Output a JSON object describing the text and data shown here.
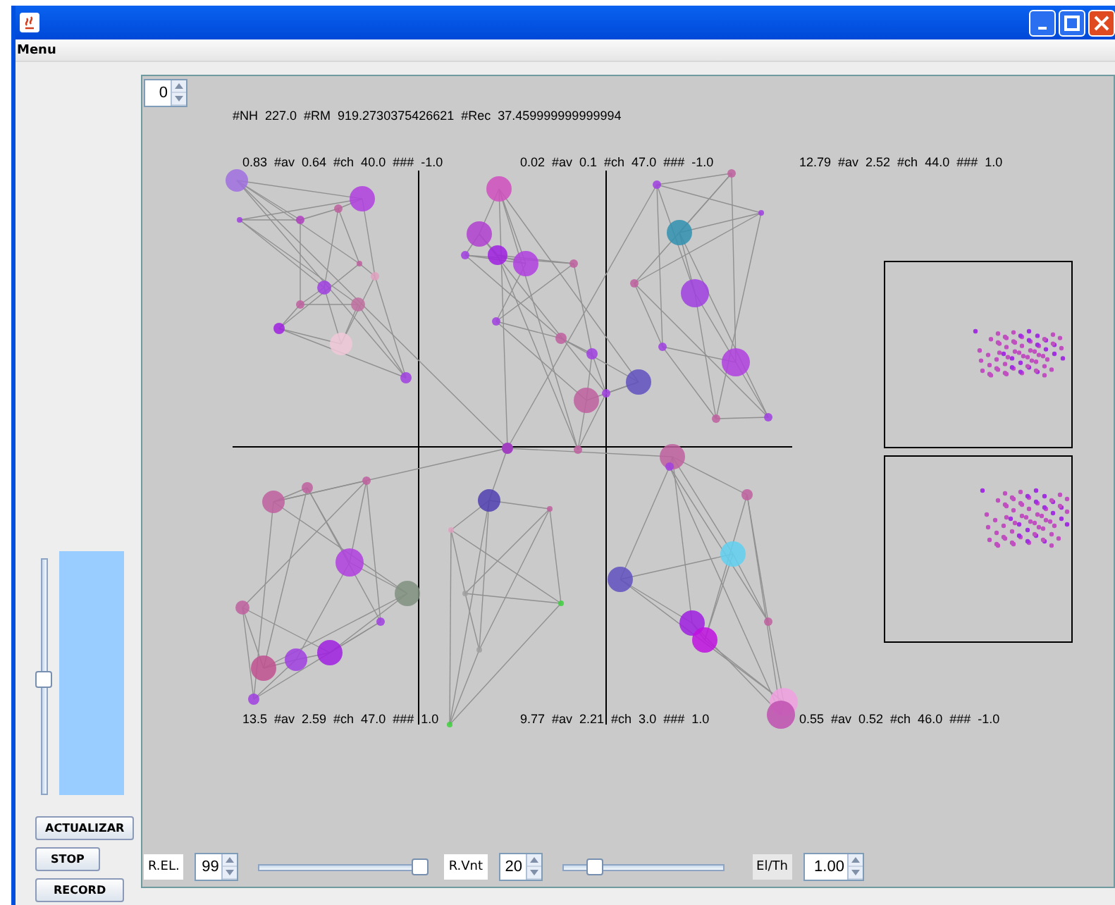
{
  "menu_bar": {
    "items": [
      "Menu"
    ]
  },
  "side_panel": {
    "slider": {
      "level": 0.49
    },
    "buttons": [
      "ACTUALIZAR",
      "STOP",
      "RECORD"
    ]
  },
  "canvas": {
    "spinner": {
      "value": "0"
    },
    "summary": "#NH  227.0  #RM  919.2730375426621  #Rec  37.459999999999994",
    "quadrant_labels": [
      "0.83  #av  0.64  #ch  40.0  ###  -1.0",
      "0.02  #av  0.1  #ch  47.0  ###  -1.0",
      "12.79  #av  2.52  #ch  44.0  ###  1.0",
      "13.5  #av  2.59  #ch  47.0  ###  1.0",
      "9.77  #av  2.21  #ch  3.0  ###  1.0",
      "0.55  #av  0.52  #ch  46.0  ###  -1.0"
    ]
  },
  "controls": [
    {
      "kind": "label",
      "text": "R.EL."
    },
    {
      "kind": "spinner",
      "value": "99"
    },
    {
      "kind": "slider",
      "level": 0.97
    },
    {
      "kind": "label",
      "text": "R.Vnt"
    },
    {
      "kind": "spinner",
      "value": "20"
    },
    {
      "kind": "slider",
      "level": 0.2
    },
    {
      "kind": "label",
      "text": "El/Th"
    },
    {
      "kind": "spinner",
      "value": "1.00"
    }
  ]
}
